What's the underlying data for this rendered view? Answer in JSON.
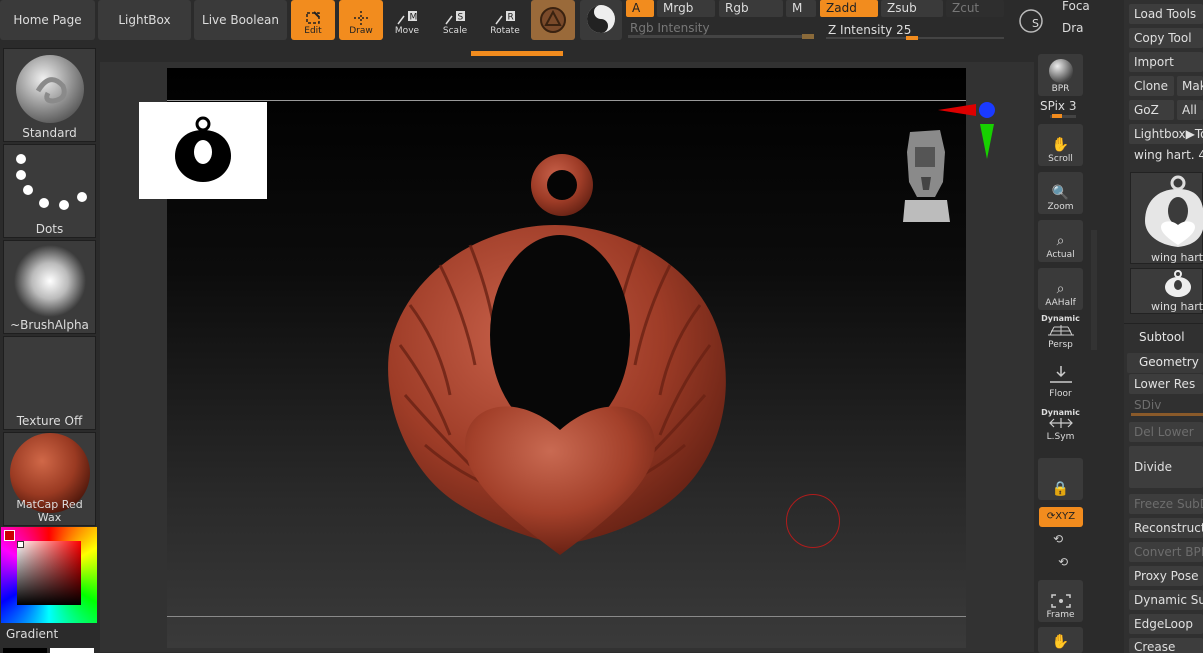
{
  "top": {
    "home": "Home Page",
    "lightbox": "LightBox",
    "live_boolean": "Live Boolean",
    "tools": [
      {
        "label": "Edit",
        "icon": "edit-icon",
        "on": true
      },
      {
        "label": "Draw",
        "icon": "draw-icon",
        "on": true
      },
      {
        "label": "Move",
        "icon": "move-icon",
        "on": false
      },
      {
        "label": "Scale",
        "icon": "scale-icon",
        "on": false
      },
      {
        "label": "Rotate",
        "icon": "rotate-icon",
        "on": false
      }
    ],
    "a": "A",
    "mrgb": "Mrgb",
    "rgb": "Rgb",
    "m": "M",
    "rgb_intensity": "Rgb Intensity",
    "zadd": "Zadd",
    "zsub": "Zsub",
    "zcut": "Zcut",
    "z_intensity_label": "Z Intensity",
    "z_intensity": "25",
    "focal": "Foca",
    "draw": "Dra"
  },
  "left": {
    "standard": "Standard",
    "dots": "Dots",
    "brush_alpha": "~BrushAlpha",
    "texture": "Texture Off",
    "matcap": "MatCap Red Wax",
    "gradient": "Gradient"
  },
  "right_shelf": {
    "bpr": "BPR",
    "spix_label": "SPix",
    "spix": "3",
    "buttons": [
      {
        "label": "Scroll",
        "icon": "scroll-icon"
      },
      {
        "label": "Zoom",
        "icon": "zoom-icon"
      },
      {
        "label": "Actual",
        "icon": "actual-icon"
      },
      {
        "label": "AAHalf",
        "icon": "aahalf-icon"
      }
    ],
    "dynamic1": "Dynamic",
    "persp": "Persp",
    "floor": "Floor",
    "dynamic2": "Dynamic",
    "lsym": "L.Sym",
    "xyz": "XYZ",
    "frame": "Frame"
  },
  "tool_palette": {
    "load_tools": "Load Tools",
    "copy_tool": "Copy Tool",
    "import": "Import",
    "clone": "Clone",
    "make": "Mak",
    "goz": "GoZ",
    "all": "All",
    "lightbox_tools": "Lightbox▶To",
    "current_tool": "wing hart. 4",
    "thumb1": "wing hart",
    "thumb2": "wing hart",
    "subtool": "Subtool",
    "geometry": "Geometry",
    "lower_res": "Lower Res",
    "sdiv": "SDiv",
    "del_lower": "Del Lower",
    "divide": "Divide",
    "freeze": "Freeze SubD",
    "reconstruct": "Reconstruct",
    "convert_bpr": "Convert BPR",
    "proxy_pose": "Proxy Pose",
    "dynamic_sub": "Dynamic Sub",
    "edgeloop": "EdgeLoop",
    "crease": "Crease"
  }
}
